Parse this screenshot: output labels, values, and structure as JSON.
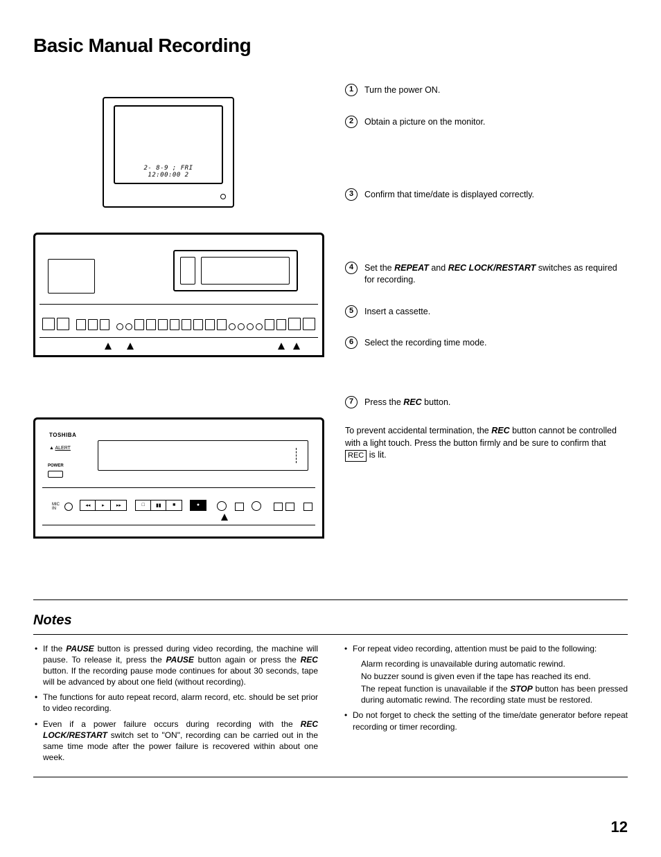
{
  "title": "Basic Manual Recording",
  "monitor": {
    "line1": "2- 8-9 ; FRI",
    "line2": "12:00:00   2"
  },
  "steps": [
    {
      "n": "1",
      "text": "Turn the power ON."
    },
    {
      "n": "2",
      "text": "Obtain a picture on the monitor."
    },
    {
      "n": "3",
      "text": "Confirm that time/date is displayed correctly."
    },
    {
      "n": "4",
      "pre": "Set the ",
      "b1": "REPEAT",
      "mid": " and ",
      "b2": "REC LOCK/RESTART",
      "post": " switches as required for recording."
    },
    {
      "n": "5",
      "text": "Insert a cassette."
    },
    {
      "n": "6",
      "text": "Select the recording time mode."
    },
    {
      "n": "7",
      "pre": "Press the ",
      "b1": "REC",
      "post": " button."
    }
  ],
  "rec_warning": {
    "pre": "To prevent accidental termination, the ",
    "b1": "REC",
    "mid": " button cannot be controlled with a light touch. Press the button firmly and be sure to confirm that ",
    "box": "REC",
    "post": " is lit."
  },
  "vcr2_brand": "TOSHIBA",
  "vcr2_power": "POWER",
  "notes_title": "Notes",
  "notes_left": [
    {
      "pre": "If the ",
      "b1": "PAUSE",
      "mid1": " button is pressed during video recording, the machine will pause. To release it, press the ",
      "b2": "PAUSE",
      "mid2": " button again or press the ",
      "b3": "REC",
      "post": " button. If the recording pause mode continues for about 30 seconds, tape will be advanced by about one field (without recording)."
    },
    {
      "text": "The functions for auto repeat record, alarm record, etc. should be set prior to video recording."
    },
    {
      "pre": "Even if a power failure occurs during recording with the ",
      "b1": "REC LOCK/RESTART",
      "post": " switch set to \"ON\", recording can be carried out in the same time mode after the power failure is recovered within about one week."
    }
  ],
  "notes_right": [
    {
      "text": "For repeat video recording, attention must be paid to the following:",
      "subs": [
        "Alarm recording is unavailable during automatic rewind.",
        "No buzzer sound is given even if the tape has reached its end.",
        {
          "pre": "The repeat function is unavailable if the ",
          "b1": "STOP",
          "post": " button has been pressed during automatic rewind. The recording state must be restored."
        }
      ]
    },
    {
      "text": "Do not forget to check the setting of the time/date generator before repeat recording or timer recording."
    }
  ],
  "page_number": "12"
}
